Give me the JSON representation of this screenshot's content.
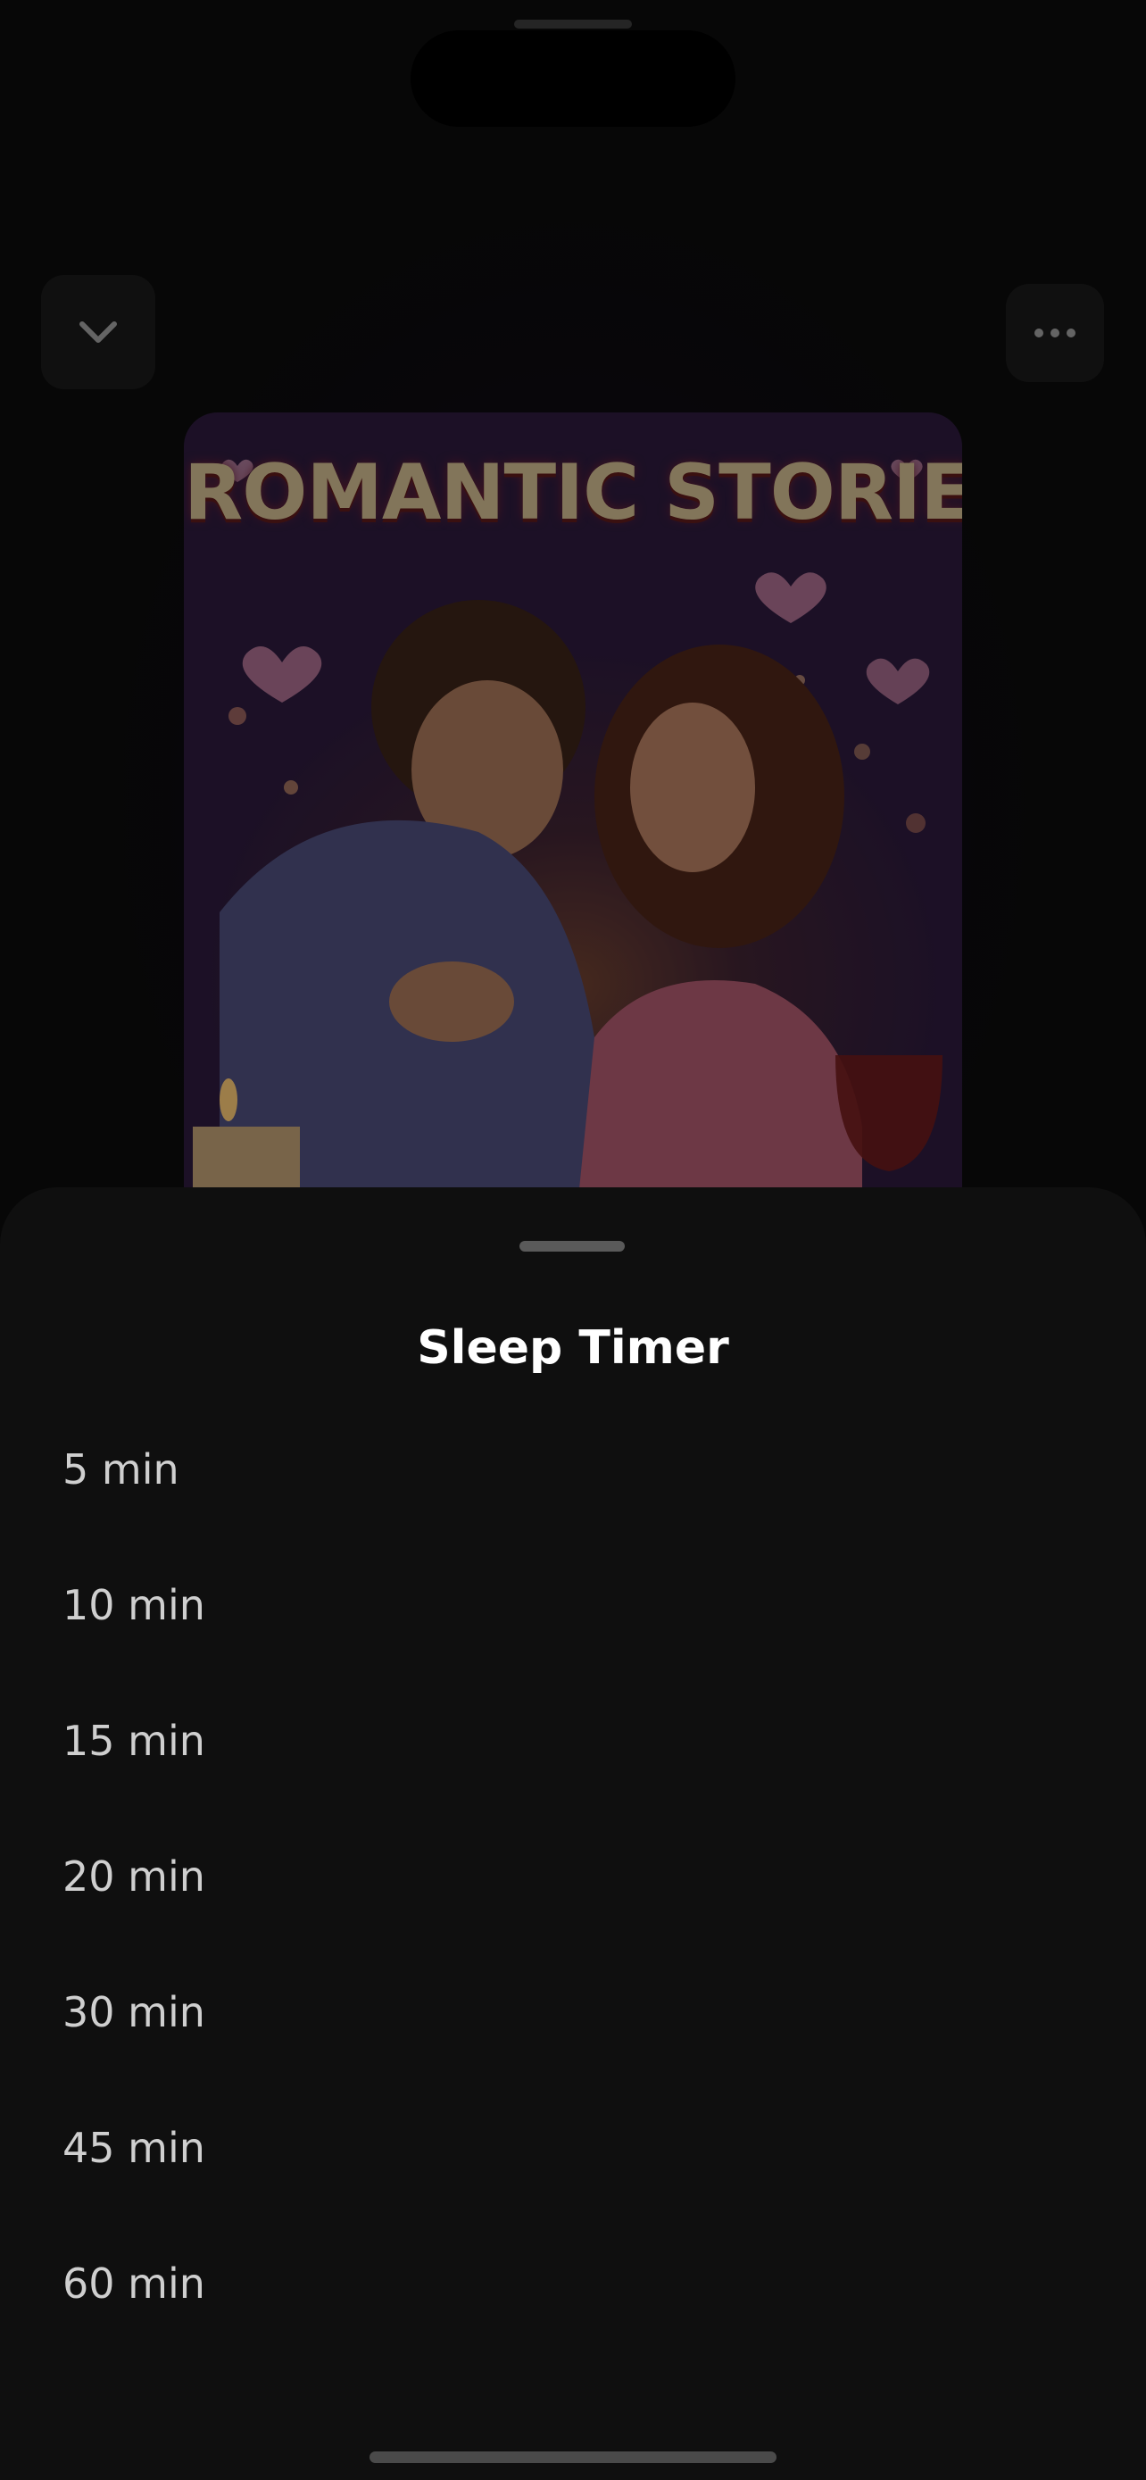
{
  "player": {
    "cover_title": "ROMANTIC STORIES",
    "collapse_icon": "chevron-down-icon",
    "more_icon": "ellipsis-icon"
  },
  "sleep_timer": {
    "title": "Sleep Timer",
    "options": [
      "5 min",
      "10 min",
      "15 min",
      "20 min",
      "30 min",
      "45 min",
      "60 min"
    ]
  }
}
